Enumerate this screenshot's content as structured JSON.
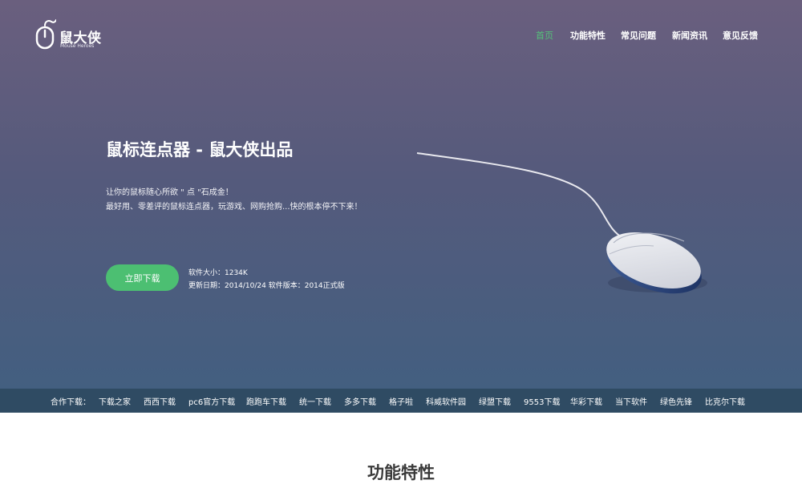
{
  "brand": {
    "name": "鼠大侠",
    "subtitle": "Mouse Heroes",
    "logo_icon": "mouse-logo-icon"
  },
  "nav": {
    "items": [
      {
        "label": "首页",
        "active": true
      },
      {
        "label": "功能特性",
        "active": false
      },
      {
        "label": "常见问题",
        "active": false
      },
      {
        "label": "新闻资讯",
        "active": false
      },
      {
        "label": "意见反馈",
        "active": false
      }
    ]
  },
  "hero": {
    "headline": "鼠标连点器 - 鼠大侠出品",
    "desc_line1": "让你的鼠标随心所欲 \" 点 \"石成金！",
    "desc_line2": "最好用、零差评的鼠标连点器，玩游戏、网购抢购...快的根本停不下来！",
    "download_label": "立即下载",
    "size_text": "软件大小：1234K",
    "update_text": "更新日期：2014/10/24 软件版本：2014正式版",
    "illustration_icon": "computer-mouse-icon"
  },
  "partners": {
    "label": "合作下载：",
    "links": [
      "下载之家",
      "西西下载",
      "pc6官方下载",
      "跑跑车下载",
      "统一下载",
      "多多下载",
      "格子啦",
      "科威软件园",
      "绿盟下载",
      "9553下载",
      "华彩下载",
      "当下软件",
      "绿色先锋",
      "比克尔下载"
    ]
  },
  "features": {
    "title": "功能特性"
  },
  "colors": {
    "accent": "#4cbf72",
    "hero_top": "#6a5f7e",
    "hero_bottom": "#435f80",
    "partner_bar": "#2f4b63",
    "nav_active": "#55c27a"
  }
}
